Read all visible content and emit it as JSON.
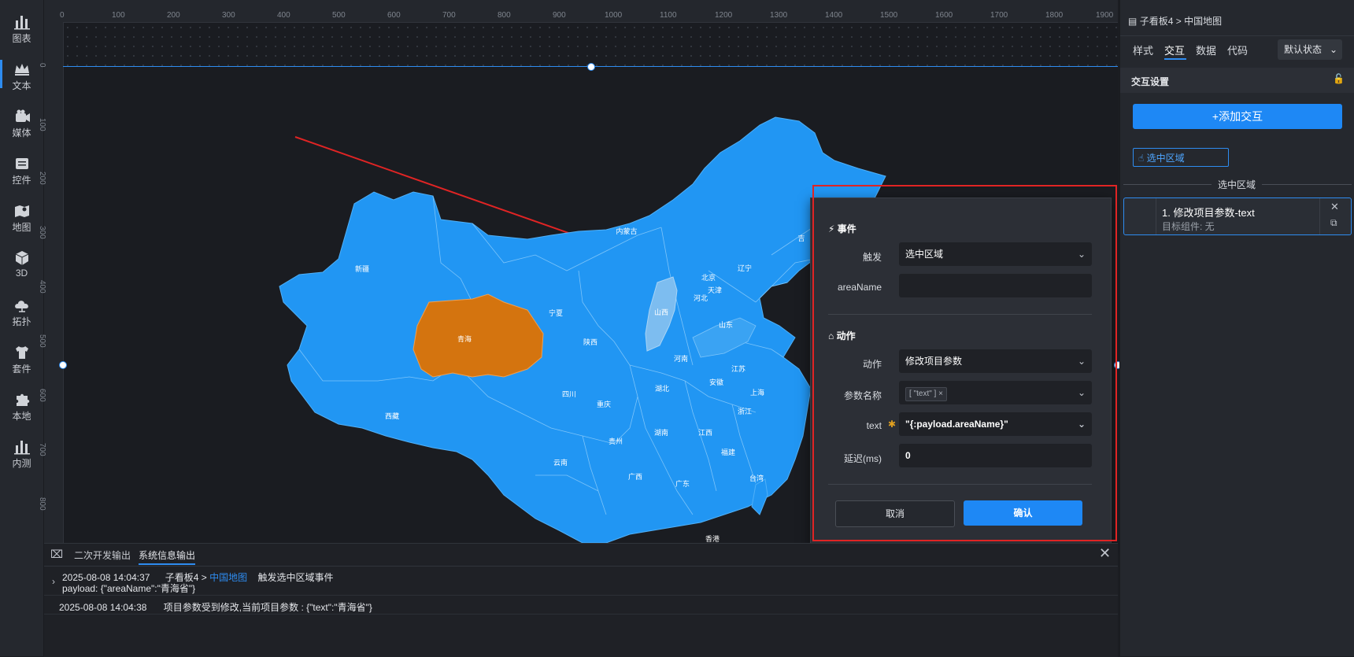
{
  "leftbar": {
    "items": [
      {
        "label": "图表",
        "icon": "bar-chart-icon"
      },
      {
        "label": "文本",
        "icon": "crown-text-icon"
      },
      {
        "label": "媒体",
        "icon": "media-icon"
      },
      {
        "label": "控件",
        "icon": "control-icon"
      },
      {
        "label": "地图",
        "icon": "map-icon"
      },
      {
        "label": "3D",
        "icon": "cube-icon"
      },
      {
        "label": "拓扑",
        "icon": "topology-icon"
      },
      {
        "label": "套件",
        "icon": "shirt-icon"
      },
      {
        "label": "本地",
        "icon": "puzzle-icon"
      },
      {
        "label": "内测",
        "icon": "beta-chart-icon"
      }
    ]
  },
  "ruler": {
    "top": [
      "0",
      "100",
      "200",
      "300",
      "400",
      "500",
      "600",
      "700",
      "800",
      "900",
      "1000",
      "1100",
      "1200",
      "1300",
      "1400",
      "1500",
      "1600",
      "1700",
      "1800",
      "1900"
    ],
    "left": [
      "0",
      "100",
      "200",
      "300",
      "400",
      "500",
      "600",
      "700",
      "800"
    ]
  },
  "map": {
    "provinces": [
      "新疆",
      "西藏",
      "青海",
      "内蒙古",
      "宁夏",
      "陕西",
      "山西",
      "河北",
      "北京",
      "天津",
      "辽宁",
      "吉",
      "山东",
      "河南",
      "江苏",
      "安徽",
      "上海",
      "湖北",
      "四川",
      "重庆",
      "浙江",
      "湖南",
      "江西",
      "贵州",
      "云南",
      "广西",
      "广东",
      "福建",
      "台湾",
      "香港"
    ],
    "highlight": "青海",
    "highlight_color": "#d4740f",
    "light": "山西",
    "light_color": "#7dbdf0",
    "base_color": "#2196f3"
  },
  "dialog": {
    "event_title": "事件",
    "trigger_label": "触发",
    "trigger_value": "选中区域",
    "areaname_label": "areaName",
    "areaname_value": "",
    "action_title": "动作",
    "action_label": "动作",
    "action_value": "修改项目参数",
    "param_label": "参数名称",
    "param_tag": "[ \"text\" ]",
    "text_label": "text",
    "text_value": "\"{:payload.areaName}\"",
    "delay_label": "延迟(ms)",
    "delay_value": "0",
    "cancel": "取消",
    "confirm": "确认"
  },
  "rpanel": {
    "breadcrumb_parent": "子看板4",
    "breadcrumb_sep": ">",
    "breadcrumb_current": "中国地图",
    "tabs": [
      "样式",
      "交互",
      "数据",
      "代码"
    ],
    "state_select": "默认状态",
    "section_title": "交互设置",
    "add_button": "+添加交互",
    "event_chip": "选中区域",
    "group_title": "选中区域",
    "item_title": "1. 修改项目参数-text",
    "item_sub": "目标组件: 无"
  },
  "console": {
    "tabs": [
      "二次开发输出",
      "系统信息输出"
    ],
    "line1_time": "2025-08-08 14:04:37",
    "line1_parent": "子看板4 >",
    "line1_link": "中国地图",
    "line1_msg": "触发选中区域事件",
    "line1_payload": "payload: {\"areaName\":\"青海省\"}",
    "line2_time": "2025-08-08 14:04:38",
    "line2_msg": "项目参数受到修改,当前项目参数 : {\"text\":\"青海省\"}"
  },
  "colors": {
    "accent": "#1e88f5",
    "alert_box": "#e02424"
  }
}
